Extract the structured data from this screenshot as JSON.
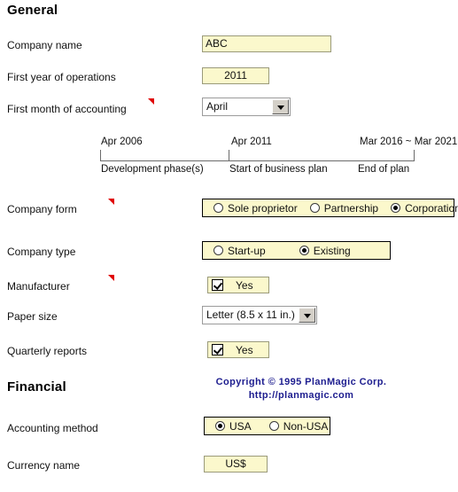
{
  "sections": {
    "general": {
      "title": "General"
    },
    "financial": {
      "title": "Financial"
    }
  },
  "rows": {
    "company_name": {
      "label": "Company name",
      "value": "ABC"
    },
    "first_year": {
      "label": "First year of operations",
      "value": "2011"
    },
    "first_month": {
      "label": "First month of accounting",
      "value": "April"
    },
    "company_form": {
      "label": "Company form"
    },
    "company_type": {
      "label": "Company type"
    },
    "manufacturer": {
      "label": "Manufacturer",
      "value": "Yes",
      "checked": true
    },
    "paper_size": {
      "label": "Paper size",
      "value": "Letter (8.5 x 11 in.)"
    },
    "quarterly_reports": {
      "label": "Quarterly reports",
      "value": "Yes",
      "checked": true
    },
    "accounting_method": {
      "label": "Accounting method"
    },
    "currency_name": {
      "label": "Currency name",
      "value": "US$"
    }
  },
  "company_form_options": [
    {
      "label": "Sole proprietor",
      "selected": false
    },
    {
      "label": "Partnership",
      "selected": false
    },
    {
      "label": "Corporation",
      "selected": true
    }
  ],
  "company_type_options": [
    {
      "label": "Start-up",
      "selected": false
    },
    {
      "label": "Existing",
      "selected": true
    }
  ],
  "accounting_method_options": [
    {
      "label": "USA",
      "selected": true
    },
    {
      "label": "Non-USA",
      "selected": false
    }
  ],
  "timeline": {
    "dates": [
      "Apr 2006",
      "Apr 2011",
      "Mar 2016 ~ Mar 2021"
    ],
    "captions": [
      "Development phase(s)",
      "Start of business plan",
      "End of plan"
    ]
  },
  "copyright": {
    "line1": "Copyright © 1995 PlanMagic Corp.",
    "line2": "http://planmagic.com"
  },
  "markers": {
    "icon": "red-comment-marker"
  }
}
